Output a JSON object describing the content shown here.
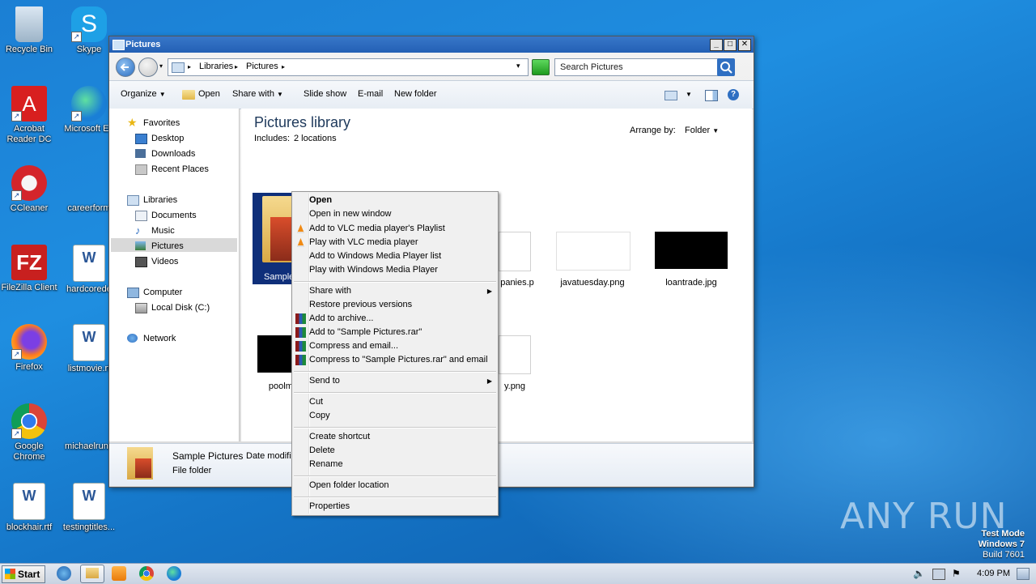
{
  "desktop": {
    "icons": [
      {
        "label": "Recycle Bin",
        "icon": "recycle-bin-icon"
      },
      {
        "label": "Skype",
        "icon": "skype-icon"
      },
      {
        "label": "Acrobat Reader DC",
        "icon": "acrobat-icon"
      },
      {
        "label": "Microsoft Ed",
        "icon": "edge-icon"
      },
      {
        "label": "CCleaner",
        "icon": "ccleaner-icon"
      },
      {
        "label": "careerform",
        "icon": "doc-icon"
      },
      {
        "label": "FileZilla Client",
        "icon": "filezilla-icon"
      },
      {
        "label": "hardcorede",
        "icon": "word-icon"
      },
      {
        "label": "Firefox",
        "icon": "firefox-icon"
      },
      {
        "label": "listmovie.rt",
        "icon": "word-icon"
      },
      {
        "label": "Google Chrome",
        "icon": "chrome-icon"
      },
      {
        "label": "michaelrunn",
        "icon": "doc-icon"
      },
      {
        "label": "blockhair.rtf",
        "icon": "word-icon"
      },
      {
        "label": "testingtitles...",
        "icon": "word-icon"
      }
    ]
  },
  "window": {
    "title": "Pictures",
    "controls": {
      "minimize": "_",
      "maximize": "□",
      "close": "✕"
    },
    "address": {
      "root_sep": "▸",
      "libraries": "Libraries",
      "sep": "▸",
      "pictures": "Pictures",
      "sep2": "▸",
      "dropdown": "▾"
    },
    "search_placeholder": "Search Pictures",
    "toolbar": {
      "organize": "Organize",
      "open": "Open",
      "share_with": "Share with",
      "slide_show": "Slide show",
      "email": "E-mail",
      "new_folder": "New folder"
    },
    "nav": {
      "favorites": "Favorites",
      "desktop": "Desktop",
      "downloads": "Downloads",
      "recent_places": "Recent Places",
      "libraries": "Libraries",
      "documents": "Documents",
      "music": "Music",
      "pictures": "Pictures",
      "videos": "Videos",
      "computer": "Computer",
      "local_disk": "Local Disk (C:)",
      "network": "Network"
    },
    "content": {
      "heading": "Pictures library",
      "includes_label": "Includes:",
      "includes_link": "2 locations",
      "arrange_label": "Arrange by:",
      "arrange_value": "Folder",
      "items": {
        "sample_pictures": "Sample",
        "companies": "panies.p",
        "javatuesday": "javatuesday.png",
        "loantrade": "loantrade.jpg",
        "poolma": "poolma",
        "yday": "y.png"
      }
    },
    "details": {
      "name": "Sample Pictures",
      "meta": "Date modifie",
      "type": "File folder"
    }
  },
  "context_menu": {
    "open": "Open",
    "open_new_window": "Open in new window",
    "vlc_playlist": "Add to VLC media player's Playlist",
    "vlc_play": "Play with VLC media player",
    "wmp_list": "Add to Windows Media Player list",
    "wmp_play": "Play with Windows Media Player",
    "share_with": "Share with",
    "restore": "Restore previous versions",
    "add_archive": "Add to archive...",
    "add_rar": "Add to \"Sample Pictures.rar\"",
    "compress_email": "Compress and email...",
    "compress_rar_email": "Compress to \"Sample Pictures.rar\" and email",
    "send_to": "Send to",
    "cut": "Cut",
    "copy": "Copy",
    "create_shortcut": "Create shortcut",
    "delete": "Delete",
    "rename": "Rename",
    "open_folder_location": "Open folder location",
    "properties": "Properties"
  },
  "taskbar": {
    "start": "Start",
    "clock": "4:09 PM"
  },
  "watermark": {
    "line1": "Test Mode",
    "line2": "Windows 7",
    "line3": "Build 7601",
    "brand": "ANY RUN"
  }
}
